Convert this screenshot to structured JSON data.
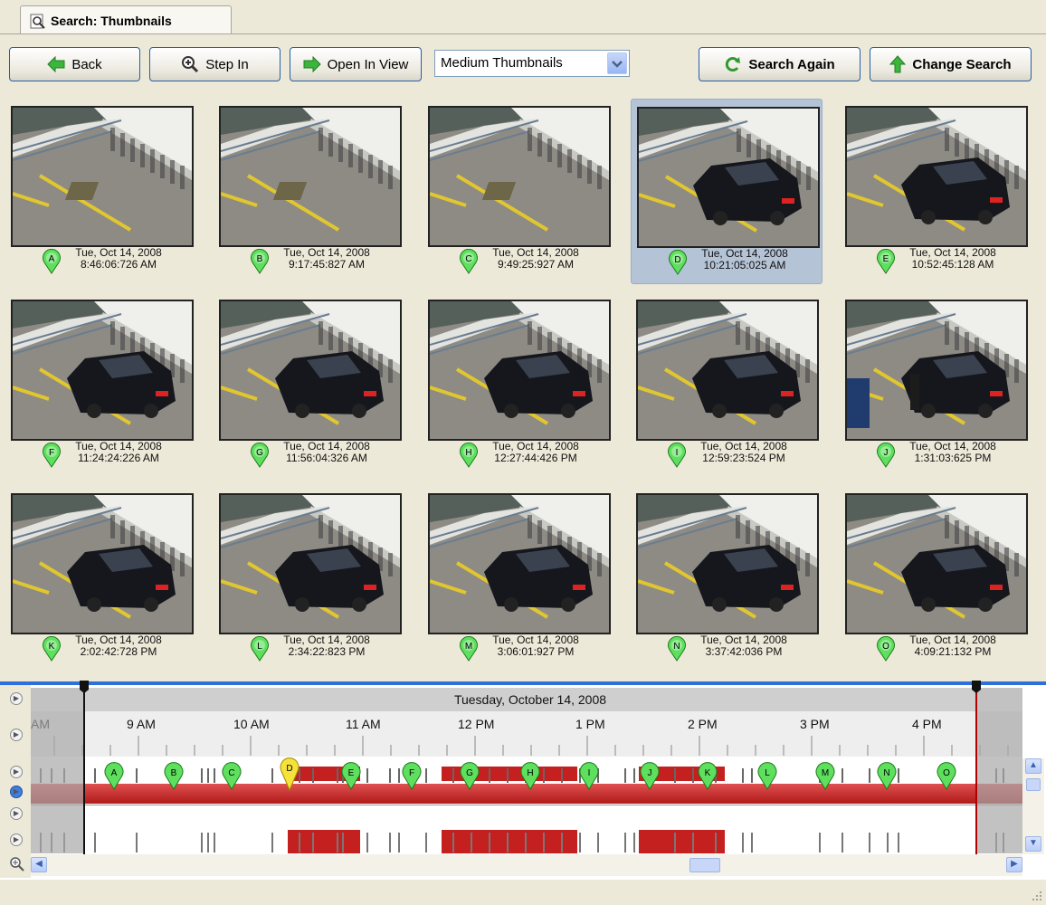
{
  "tab": {
    "title": "Search: Thumbnails",
    "icon": "search-icon"
  },
  "toolbar": {
    "back_label": "Back",
    "step_in_label": "Step In",
    "open_in_view_label": "Open In View",
    "view_select_value": "Medium Thumbnails",
    "search_again_label": "Search Again",
    "change_search_label": "Change Search"
  },
  "thumbnails": [
    {
      "letter": "A",
      "date": "Tue, Oct 14, 2008",
      "time": "8:46:06:726 AM",
      "car": false
    },
    {
      "letter": "B",
      "date": "Tue, Oct 14, 2008",
      "time": "9:17:45:827 AM",
      "car": false
    },
    {
      "letter": "C",
      "date": "Tue, Oct 14, 2008",
      "time": "9:49:25:927 AM",
      "car": false
    },
    {
      "letter": "D",
      "date": "Tue, Oct 14, 2008",
      "time": "10:21:05:025 AM",
      "car": true,
      "selected": true
    },
    {
      "letter": "E",
      "date": "Tue, Oct 14, 2008",
      "time": "10:52:45:128 AM",
      "car": true
    },
    {
      "letter": "F",
      "date": "Tue, Oct 14, 2008",
      "time": "11:24:24:226 AM",
      "car": true
    },
    {
      "letter": "G",
      "date": "Tue, Oct 14, 2008",
      "time": "11:56:04:326 AM",
      "car": true
    },
    {
      "letter": "H",
      "date": "Tue, Oct 14, 2008",
      "time": "12:27:44:426 PM",
      "car": true
    },
    {
      "letter": "I",
      "date": "Tue, Oct 14, 2008",
      "time": "12:59:23:524 PM",
      "car": true
    },
    {
      "letter": "J",
      "date": "Tue, Oct 14, 2008",
      "time": "1:31:03:625 PM",
      "car": true,
      "person": true
    },
    {
      "letter": "K",
      "date": "Tue, Oct 14, 2008",
      "time": "2:02:42:728 PM",
      "car": true
    },
    {
      "letter": "L",
      "date": "Tue, Oct 14, 2008",
      "time": "2:34:22:823 PM",
      "car": true
    },
    {
      "letter": "M",
      "date": "Tue, Oct 14, 2008",
      "time": "3:06:01:927 PM",
      "car": true
    },
    {
      "letter": "N",
      "date": "Tue, Oct 14, 2008",
      "time": "3:37:42:036 PM",
      "car": true
    },
    {
      "letter": "O",
      "date": "Tue, Oct 14, 2008",
      "time": "4:09:21:132 PM",
      "car": true
    }
  ],
  "timeline": {
    "date_label": "Tuesday, October 14, 2008",
    "hours": [
      "AM",
      "9 AM",
      "10 AM",
      "11 AM",
      "12 PM",
      "1 PM",
      "2 PM",
      "3 PM",
      "4 PM"
    ],
    "markers": [
      "A",
      "B",
      "C",
      "D",
      "E",
      "F",
      "G",
      "H",
      "I",
      "J",
      "K",
      "L",
      "M",
      "N",
      "O"
    ],
    "selected_marker": "D"
  },
  "colors": {
    "accent": "#2f6fd9",
    "marker_green": "#5ee05e",
    "marker_selected": "#f5e23a",
    "motion_red": "#c42020"
  }
}
